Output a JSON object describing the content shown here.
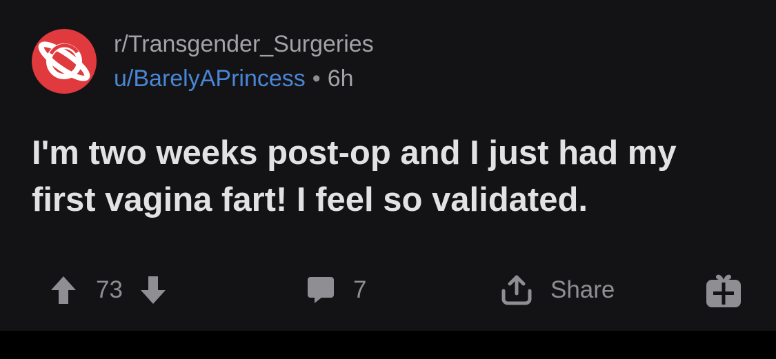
{
  "post": {
    "subreddit": "r/Transgender_Surgeries",
    "author": "u/BarelyAPrincess",
    "separator": "•",
    "time": "6h",
    "title": "I'm two weeks post-op and I just had my first vagina fart! I feel so validated."
  },
  "actions": {
    "upvote_icon": "arrow-up-icon",
    "score": "73",
    "downvote_icon": "arrow-down-icon",
    "comment_icon": "comment-bubble-icon",
    "comments": "7",
    "share_icon": "share-icon",
    "share_label": "Share",
    "award_icon": "gift-icon"
  },
  "colors": {
    "background": "#131315",
    "avatar": "#e03a3e",
    "username": "#4a86d6",
    "title_text": "#e2e2e4",
    "muted_text": "#a3a3a7",
    "icon": "#8e8e93"
  }
}
